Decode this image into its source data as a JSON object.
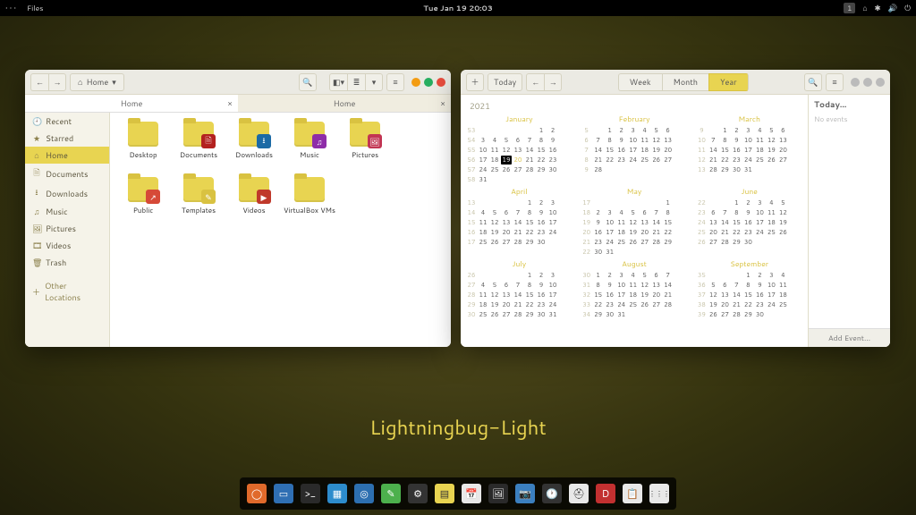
{
  "topbar": {
    "app": "Files",
    "clock": "Tue Jan 19  20:03",
    "workspace": "1"
  },
  "files": {
    "path_label": "Home",
    "tabs": [
      {
        "label": "Home",
        "active": true
      },
      {
        "label": "Home",
        "active": false
      }
    ],
    "sidebar": [
      {
        "icon": "🕘",
        "label": "Recent"
      },
      {
        "icon": "★",
        "label": "Starred"
      },
      {
        "icon": "⌂",
        "label": "Home",
        "sel": true
      },
      {
        "icon": "🗎",
        "label": "Documents"
      },
      {
        "icon": "⭳",
        "label": "Downloads"
      },
      {
        "icon": "♫",
        "label": "Music"
      },
      {
        "icon": "🖼",
        "label": "Pictures"
      },
      {
        "icon": "🎞",
        "label": "Videos"
      },
      {
        "icon": "🗑",
        "label": "Trash"
      }
    ],
    "other": "Other Locations",
    "folders": [
      {
        "name": "Desktop",
        "emblem": null
      },
      {
        "name": "Documents",
        "emblem": {
          "bg": "#b3211f",
          "glyph": "🗎"
        }
      },
      {
        "name": "Downloads",
        "emblem": {
          "bg": "#1b6aa5",
          "glyph": "⭳"
        }
      },
      {
        "name": "Music",
        "emblem": {
          "bg": "#8e2da8",
          "glyph": "♫"
        }
      },
      {
        "name": "Pictures",
        "emblem": {
          "bg": "#c23553",
          "glyph": "🖼"
        }
      },
      {
        "name": "Public",
        "emblem": {
          "bg": "#d64a38",
          "glyph": "↗"
        }
      },
      {
        "name": "Templates",
        "emblem": {
          "bg": "#d9c241",
          "glyph": "✎"
        }
      },
      {
        "name": "Videos",
        "emblem": {
          "bg": "#c0392b",
          "glyph": "▶"
        }
      },
      {
        "name": "VirtualBox VMs",
        "emblem": null
      }
    ]
  },
  "calendar": {
    "views": [
      "Week",
      "Month",
      "Year"
    ],
    "active_view": 2,
    "today_btn": "Today",
    "year": "2021",
    "events_header": "Today…",
    "no_events": "No events",
    "add_event": "Add Event…",
    "months": [
      "January",
      "February",
      "March",
      "April",
      "May",
      "June",
      "July",
      "August",
      "September"
    ],
    "first_dow": [
      5,
      1,
      1,
      4,
      6,
      2,
      4,
      0,
      3
    ],
    "days_in": [
      31,
      28,
      31,
      30,
      31,
      30,
      31,
      31,
      30
    ],
    "start_week": [
      53,
      5,
      9,
      13,
      17,
      22,
      26,
      30,
      35
    ],
    "today": {
      "month": 0,
      "day": 19
    }
  },
  "theme_name": "Lightningbug-Light",
  "dock": [
    {
      "bg": "#e06a2b",
      "g": "◯"
    },
    {
      "bg": "#2f6fb3",
      "g": "▭"
    },
    {
      "bg": "#2a2a2a",
      "g": ">_"
    },
    {
      "bg": "#2d8ccc",
      "g": "▦"
    },
    {
      "bg": "#2d6fb0",
      "g": "◎"
    },
    {
      "bg": "#4db04d",
      "g": "✎"
    },
    {
      "bg": "#333",
      "g": "⚙"
    },
    {
      "bg": "#e8d451",
      "g": "▤"
    },
    {
      "bg": "#e8e8e8",
      "g": "📅"
    },
    {
      "bg": "#2a2a2a",
      "g": "🖼"
    },
    {
      "bg": "#3b7fbf",
      "g": "📷"
    },
    {
      "bg": "#333",
      "g": "🕐"
    },
    {
      "bg": "#e8e8e8",
      "g": "⛑"
    },
    {
      "bg": "#c23030",
      "g": "D"
    },
    {
      "bg": "#e8e8e8",
      "g": "📋"
    },
    {
      "bg": "#e8e8e8",
      "g": "⋮⋮⋮"
    }
  ]
}
